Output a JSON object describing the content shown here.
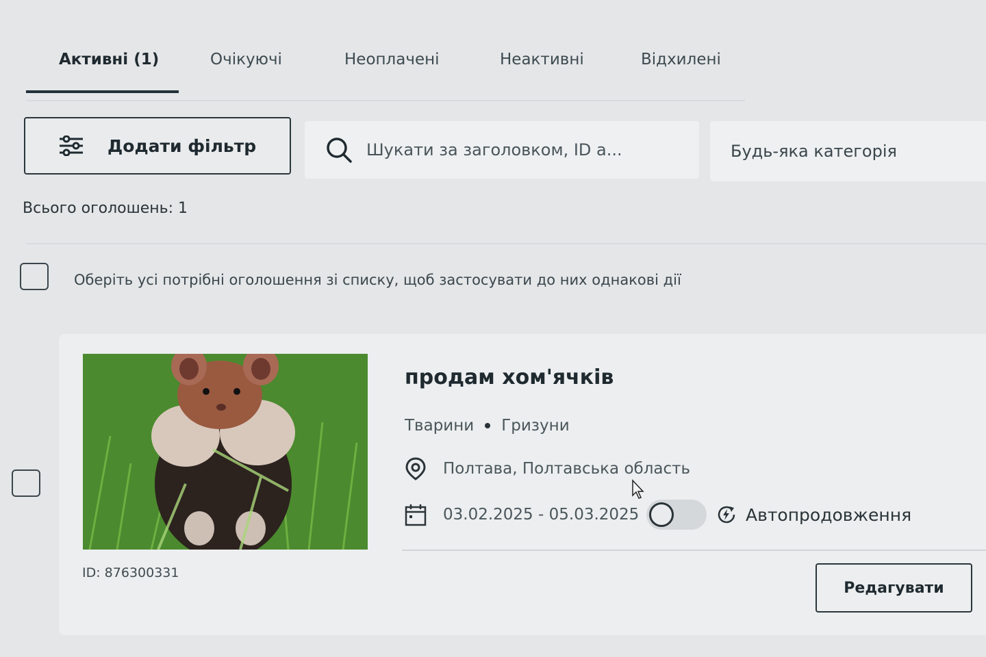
{
  "tabs": [
    {
      "label": "Активні (1)",
      "active": true
    },
    {
      "label": "Очікуючі",
      "active": false
    },
    {
      "label": "Неоплачені",
      "active": false
    },
    {
      "label": "Неактивні",
      "active": false
    },
    {
      "label": "Відхилені",
      "active": false
    }
  ],
  "toolbar": {
    "filter_label": "Додати фільтр",
    "filter_icon": "sliders-icon",
    "search_placeholder": "Шукати за заголовком, ID а...",
    "search_icon": "search-icon",
    "category_label": "Будь-яка категорія"
  },
  "summary": {
    "total_text": "Всього оголошень: 1"
  },
  "bulk": {
    "select_all_text": "Оберіть усі потрібні оголошення зі списку, щоб застосувати до них однакові дії"
  },
  "listing": {
    "title": "продам хом'ячків",
    "category": "Тварини",
    "subcategory": "Гризуни",
    "location": "Полтава, Полтавська область",
    "dates": "03.02.2025 - 05.03.2025",
    "autoprolong_label": "Автопродовження",
    "autoprolong_on": false,
    "id_text": "ID: 876300331",
    "edit_label": "Редагувати",
    "location_icon": "location-pin-icon",
    "calendar_icon": "calendar-icon",
    "autoprolong_icon": "refresh-bolt-icon"
  },
  "colors": {
    "background": "#e4e6e8",
    "text": "#1f2a30",
    "card": "#eceeef",
    "border": "#2a353b"
  }
}
